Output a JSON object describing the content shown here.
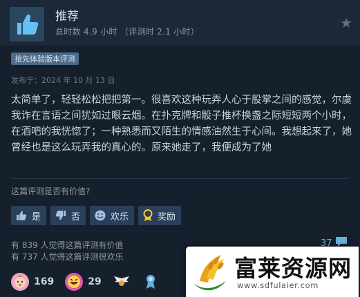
{
  "review": {
    "recommendation": "推荐",
    "hours": "总时数 4.9 小时 （评测时 2.1 小时）",
    "early_access_badge": "抢先体验版本评测",
    "posted": "发布于：2024 年 10 月 13 日",
    "body": "太简单了，轻轻松松把把第一。很喜欢这种玩弄人心于股掌之间的感觉，尔虞我诈在言语之间犹如过眼云烟。在扑克牌和骰子推杯换盏之际短短两个小时，在酒吧的我恍惚了；一种熟悉而又陌生的情感油然生于心间。我想起来了，她曾经也是这么玩弄我的真心的。原来她走了，我便成为了她"
  },
  "helpful": {
    "question": "这篇评测是否有价值?",
    "buttons": {
      "yes": "是",
      "no": "否",
      "funny": "欢乐",
      "award": "奖励"
    },
    "stat_helpful": "有 839 人觉得这篇评测有价值",
    "stat_funny": "有 737 人觉得这篇评测很欢乐",
    "comment_count": "37"
  },
  "awards": [
    {
      "icon": "baby-face-icon",
      "count": "169",
      "color": "#f0a6c0"
    },
    {
      "icon": "grinning-face-icon",
      "count": "29",
      "color": "#e05aa8"
    },
    {
      "icon": "winged-award-icon",
      "count": "",
      "color": "#ffffff"
    },
    {
      "icon": "ribbon-medal-icon",
      "count": "",
      "color": "#66b0e0"
    }
  ],
  "watermark": {
    "title": "富莱资源网",
    "url": "www.sdfulaier.com"
  },
  "colors": {
    "background": "#16202d",
    "header": "#1b2838",
    "button": "#2a3f5a",
    "accent": "#66b0e0",
    "thumb_tile": "#2a475e"
  }
}
